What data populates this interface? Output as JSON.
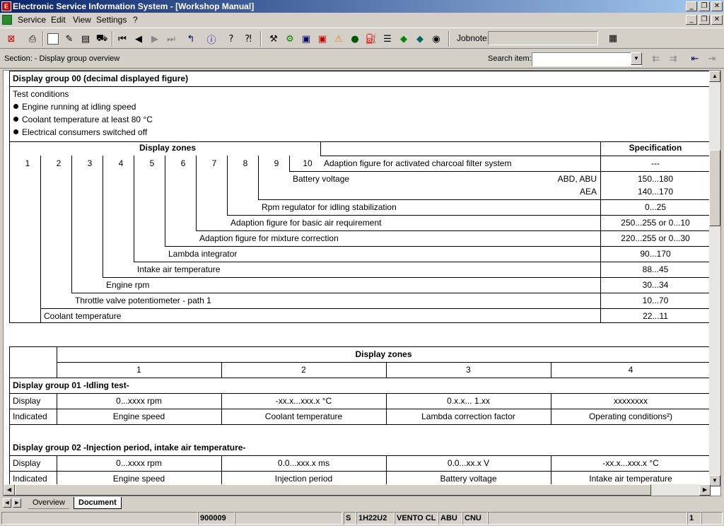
{
  "window": {
    "title": "Electronic Service Information System - [Workshop Manual]"
  },
  "menu": {
    "items": [
      "Service",
      "Edit",
      "View",
      "Settings",
      "?"
    ]
  },
  "toolbar": {
    "jobnote_label": "Jobnote:",
    "jobnote_value": ""
  },
  "section": {
    "label": "Section: - Display group overview",
    "search_label": "Search item:",
    "search_value": ""
  },
  "dg00": {
    "title": "Display group 00 (decimal displayed figure)",
    "test_conditions": "Test conditions",
    "bullets": [
      "Engine running at idling speed",
      "Coolant temperature at least 80 °C",
      "Electrical consumers switched off"
    ],
    "zones_header": "Display zones",
    "spec_header": "Specification",
    "zone_numbers": [
      "1",
      "2",
      "3",
      "4",
      "5",
      "6",
      "7",
      "8",
      "9",
      "10"
    ],
    "rows": [
      {
        "label": "Adaption figure for activated charcoal filter system",
        "spec": "---"
      },
      {
        "label": "Battery voltage",
        "variant1": "ABD, ABU",
        "spec1": "150...180",
        "variant2": "AEA",
        "spec2": "140...170"
      },
      {
        "label": "Rpm regulator for idling stabilization",
        "spec": "0...25"
      },
      {
        "label": "Adaption figure for basic air requirement",
        "spec": "250...255 or 0...10"
      },
      {
        "label": "Adaption figure for mixture correction",
        "spec": "220...255 or 0...30"
      },
      {
        "label": "Lambda integrator",
        "spec": "90...170"
      },
      {
        "label": "Intake air temperature",
        "spec": "88...45"
      },
      {
        "label": "Engine rpm",
        "spec": "30...34"
      },
      {
        "label": "Throttle valve potentiometer - path 1",
        "spec": "10...70"
      },
      {
        "label": "Coolant temperature",
        "spec": "22...11"
      }
    ]
  },
  "table2": {
    "zones_header": "Display zones",
    "zone_numbers": [
      "1",
      "2",
      "3",
      "4"
    ],
    "groups": [
      {
        "title": "Display group 01 -Idling test-",
        "display_label": "Display",
        "indicated_label": "Indicated",
        "display": [
          "0...xxxx rpm",
          "-xx.x...xxx.x °C",
          "0.x.x... 1.xx",
          "xxxxxxxx"
        ],
        "indicated": [
          "Engine speed",
          "Coolant temperature",
          "Lambda correction factor",
          "Operating conditions²)"
        ]
      },
      {
        "title": "Display group 02 -Injection period, intake air temperature-",
        "display_label": "Display",
        "indicated_label": "Indicated",
        "display": [
          "0...xxxx rpm",
          "0.0...xxx.x ms",
          "0.0...xx.x V",
          "-xx.x...xxx.x °C"
        ],
        "indicated": [
          "Engine speed",
          "Injection period",
          "Battery voltage",
          "Intake air temperature"
        ]
      }
    ]
  },
  "tabs": [
    "Overview",
    "Document"
  ],
  "status": {
    "code": "900009",
    "s": "S",
    "engine": "1H22U2",
    "model": "VENTO CL",
    "abu": "ABU",
    "cnu": "CNU",
    "page": "1"
  }
}
